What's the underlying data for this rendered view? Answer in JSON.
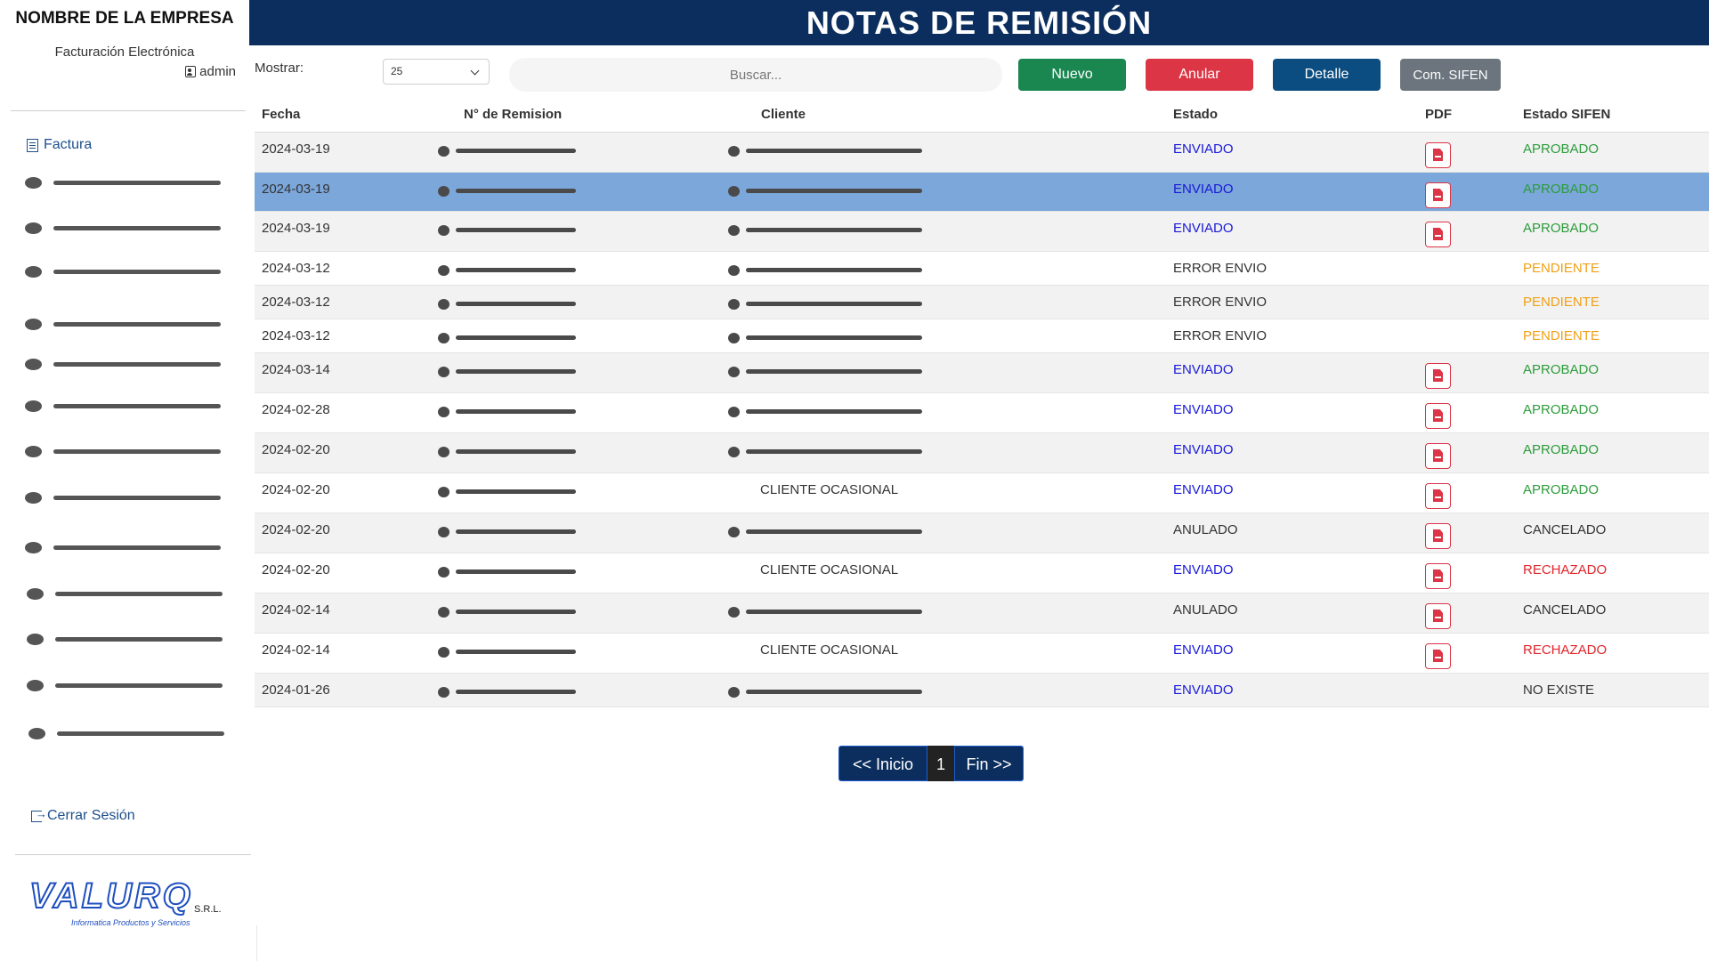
{
  "sidebar": {
    "company": "NOMBRE DE LA EMPRESA",
    "subtitle": "Facturación Electrónica",
    "user": "admin",
    "nav_head": "Factura",
    "nav_items_count": 13,
    "logout": "Cerrar Sesión",
    "logo": {
      "word": "VALURQ",
      "srl": "S.R.L.",
      "tagline": "Informatica  Productos y Servicios"
    }
  },
  "header": {
    "title": "NOTAS DE REMISIÓN"
  },
  "toolbar": {
    "show_label": "Mostrar:",
    "show_value": "25",
    "search_placeholder": "Buscar...",
    "btn_new": "Nuevo",
    "btn_void": "Anular",
    "btn_detail": "Detalle",
    "btn_sifen": "Com. SIFEN"
  },
  "table": {
    "headers": {
      "fecha": "Fecha",
      "numero": "N° de Remision",
      "cliente": "Cliente",
      "estado": "Estado",
      "pdf": "PDF",
      "sifen": "Estado SIFEN"
    },
    "rows": [
      {
        "fecha": "2024-03-19",
        "cliente": "",
        "estado": "ENVIADO",
        "pdf": true,
        "sifen": "APROBADO"
      },
      {
        "fecha": "2024-03-19",
        "cliente": "",
        "estado": "ENVIADO",
        "pdf": true,
        "sifen": "APROBADO",
        "selected": true
      },
      {
        "fecha": "2024-03-19",
        "cliente": "",
        "estado": "ENVIADO",
        "pdf": true,
        "sifen": "APROBADO"
      },
      {
        "fecha": "2024-03-12",
        "cliente": "",
        "estado": "ERROR ENVIO",
        "pdf": false,
        "sifen": "PENDIENTE"
      },
      {
        "fecha": "2024-03-12",
        "cliente": "",
        "estado": "ERROR ENVIO",
        "pdf": false,
        "sifen": "PENDIENTE"
      },
      {
        "fecha": "2024-03-12",
        "cliente": "",
        "estado": "ERROR ENVIO",
        "pdf": false,
        "sifen": "PENDIENTE"
      },
      {
        "fecha": "2024-03-14",
        "cliente": "",
        "estado": "ENVIADO",
        "pdf": true,
        "sifen": "APROBADO"
      },
      {
        "fecha": "2024-02-28",
        "cliente": "",
        "estado": "ENVIADO",
        "pdf": true,
        "sifen": "APROBADO"
      },
      {
        "fecha": "2024-02-20",
        "cliente": "",
        "estado": "ENVIADO",
        "pdf": true,
        "sifen": "APROBADO"
      },
      {
        "fecha": "2024-02-20",
        "cliente": "CLIENTE OCASIONAL",
        "estado": "ENVIADO",
        "pdf": true,
        "sifen": "APROBADO"
      },
      {
        "fecha": "2024-02-20",
        "cliente": "",
        "estado": "ANULADO",
        "pdf": true,
        "sifen": "CANCELADO"
      },
      {
        "fecha": "2024-02-20",
        "cliente": "CLIENTE OCASIONAL",
        "estado": "ENVIADO",
        "pdf": true,
        "sifen": "RECHAZADO"
      },
      {
        "fecha": "2024-02-14",
        "cliente": "",
        "estado": "ANULADO",
        "pdf": true,
        "sifen": "CANCELADO"
      },
      {
        "fecha": "2024-02-14",
        "cliente": "CLIENTE OCASIONAL",
        "estado": "ENVIADO",
        "pdf": true,
        "sifen": "RECHAZADO"
      },
      {
        "fecha": "2024-01-26",
        "cliente": "",
        "estado": "ENVIADO",
        "pdf": false,
        "sifen": "NO EXISTE"
      }
    ]
  },
  "pagination": {
    "first": "<< Inicio",
    "current": "1",
    "last": "Fin >>"
  },
  "colors": {
    "header_bg": "#0b2e5e",
    "selected_row": "#7ba7db",
    "btn_new": "#1a8751",
    "btn_void": "#dc3545",
    "btn_detail": "#0b4d80",
    "btn_sifen": "#6c757d",
    "status_enviado": "#1a1ad6",
    "sifen_aprobado": "#2d9c3c",
    "sifen_pendiente": "#f0a015",
    "sifen_rechazado": "#e0252b"
  },
  "icons": [
    "user-icon",
    "document-icon",
    "logout-icon",
    "chevron-down-icon",
    "pdf-icon"
  ]
}
